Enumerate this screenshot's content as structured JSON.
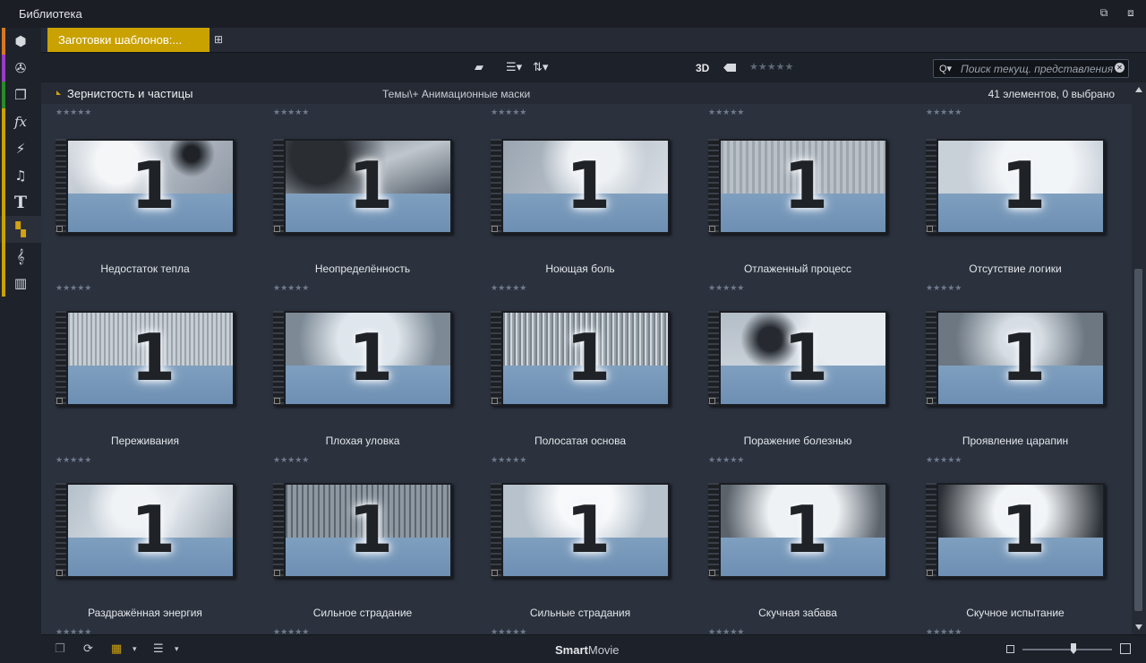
{
  "window": {
    "title": "Библиотека"
  },
  "tab": {
    "label": "Заготовки шаблонов:..."
  },
  "toolbar": {
    "view_3d": "3D",
    "rating_stars": "★★★★★"
  },
  "search": {
    "placeholder": "Поиск текущ. представления"
  },
  "group": {
    "name": "Зернистость и частицы",
    "path": "Темы\\+ Анимационные маски",
    "count": "41 элементов, 0 выбрано"
  },
  "items": [
    {
      "name": "Недостаток тепла",
      "stars": "★★★★★"
    },
    {
      "name": "Неопределённость",
      "stars": "★★★★★"
    },
    {
      "name": "Ноющая боль",
      "stars": "★★★★★"
    },
    {
      "name": "Отлаженный процесс",
      "stars": "★★★★★"
    },
    {
      "name": "Отсутствие логики",
      "stars": "★★★★★"
    },
    {
      "name": "Переживания",
      "stars": "★★★★★"
    },
    {
      "name": "Плохая уловка",
      "stars": "★★★★★"
    },
    {
      "name": "Полосатая основа",
      "stars": "★★★★★"
    },
    {
      "name": "Поражение болезнью",
      "stars": "★★★★★"
    },
    {
      "name": "Проявление царапин",
      "stars": "★★★★★"
    },
    {
      "name": "Раздражённая энергия",
      "stars": "★★★★★"
    },
    {
      "name": "Сильное страдание",
      "stars": "★★★★★"
    },
    {
      "name": "Сильные страдания",
      "stars": "★★★★★"
    },
    {
      "name": "Скучная забава",
      "stars": "★★★★★"
    },
    {
      "name": "Скучное испытание",
      "stars": "★★★★★"
    }
  ],
  "thumbnail_number": "1",
  "bottombar": {
    "logo_bold": "Smart",
    "logo_rest": "Movie"
  },
  "sidebar_colors": [
    "#d8791f",
    "#9a3bc4",
    "#2a8a2a",
    "#c9a200"
  ],
  "icons": [
    "box-icon",
    "film-reel-icon",
    "layers-icon",
    "fx-icon",
    "lightning-icon",
    "music-icon",
    "title-icon",
    "montage-icon",
    "clef-icon",
    "piano-icon"
  ]
}
